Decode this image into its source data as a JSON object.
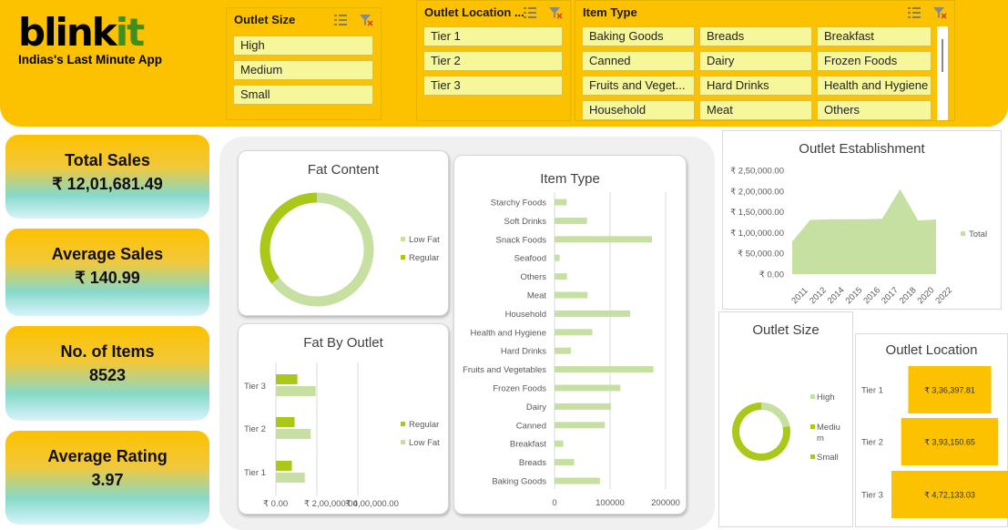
{
  "header": {
    "brand_main": "blink",
    "brand_accent": "it",
    "tagline": "Indias's Last Minute App"
  },
  "slicers": {
    "outlet_size": {
      "title": "Outlet Size",
      "items": [
        "High",
        "Medium",
        "Small"
      ]
    },
    "outlet_location": {
      "title": "Outlet Location ...",
      "items": [
        "Tier 1",
        "Tier 2",
        "Tier 3"
      ]
    },
    "item_type": {
      "title": "Item Type",
      "items": [
        "Baking Goods",
        "Breads",
        "Breakfast",
        "Canned",
        "Dairy",
        "Frozen Foods",
        "Fruits and Veget...",
        "Hard Drinks",
        "Health and Hygiene",
        "Household",
        "Meat",
        "Others"
      ]
    }
  },
  "kpis": [
    {
      "label": "Total Sales",
      "value": "₹ 12,01,681.49"
    },
    {
      "label": "Average Sales",
      "value": "₹ 140.99"
    },
    {
      "label": "No. of Items",
      "value": "8523"
    },
    {
      "label": "Average Rating",
      "value": "3.97"
    }
  ],
  "colors": {
    "header_bg": "#FCC200",
    "chip_bg": "#F6F79B",
    "dark_green": "#A9C81A",
    "light_green": "#C5E0A0",
    "bar_yellow": "#FCC200"
  },
  "chart_data": [
    {
      "type": "pie",
      "title": "Fat Content",
      "donut": true,
      "labels": [
        "Low Fat",
        "Regular"
      ],
      "values": [
        64.7,
        35.3
      ],
      "legend": "right"
    },
    {
      "type": "bar",
      "orientation": "horizontal",
      "title": "Fat By Outlet",
      "categories": [
        "Tier 1",
        "Tier 2",
        "Tier 3"
      ],
      "series": [
        {
          "name": "Regular",
          "values": [
            78000,
            91000,
            105000
          ]
        },
        {
          "name": "Low Fat",
          "values": [
            141000,
            170000,
            194000
          ]
        }
      ],
      "xlim": [
        0,
        400000
      ],
      "x_ticks": [
        "₹ 0.00",
        "₹ 2,00,000.00",
        "₹ 4,00,000.00"
      ],
      "legend": "right"
    },
    {
      "type": "bar",
      "orientation": "horizontal",
      "title": "Item Type",
      "categories": [
        "Starchy Foods",
        "Soft Drinks",
        "Snack Foods",
        "Seafood",
        "Others",
        "Meat",
        "Household",
        "Health and Hygiene",
        "Hard Drinks",
        "Fruits and Vegetables",
        "Frozen Foods",
        "Dairy",
        "Canned",
        "Breakfast",
        "Breads",
        "Baking Goods"
      ],
      "values": [
        21880,
        58514,
        175433,
        9077,
        22451,
        59449,
        135976,
        68025,
        29334,
        178124,
        118558,
        101276,
        90706,
        15596,
        35380,
        81894
      ],
      "xlim": [
        0,
        200000
      ],
      "x_ticks": [
        "0",
        "100000",
        "200000"
      ],
      "grid": true
    },
    {
      "type": "area",
      "title": "Outlet Establishment",
      "x": [
        "2011",
        "2012",
        "2014",
        "2015",
        "2016",
        "2017",
        "2018",
        "2020",
        "2022"
      ],
      "values": [
        78131,
        130477,
        131810,
        132113,
        132224,
        133103,
        204522,
        129103,
        131477
      ],
      "ylim": [
        0,
        250000
      ],
      "y_ticks": [
        "₹ 0.00",
        "₹ 50,000.00",
        "₹ 1,00,000.00",
        "₹ 1,50,000.00",
        "₹ 2,00,000.00",
        "₹ 2,50,000.00"
      ],
      "series_name": "Total",
      "legend": "right"
    },
    {
      "type": "pie",
      "title": "Outlet Size",
      "donut": true,
      "labels": [
        "High",
        "Medium",
        "Small"
      ],
      "values": [
        21.9,
        42.3,
        35.8
      ],
      "legend_labels": [
        "High",
        "Mediu m",
        "Small"
      ],
      "legend": "right"
    },
    {
      "type": "bar",
      "orientation": "horizontal",
      "funnel": true,
      "title": "Outlet Location",
      "categories": [
        "Tier 1",
        "Tier 2",
        "Tier 3"
      ],
      "values": [
        336397.81,
        393150.65,
        472133.03
      ],
      "value_labels": [
        "₹ 3,36,397.81",
        "₹ 3,93,150.65",
        "₹ 4,72,133.03"
      ]
    }
  ]
}
